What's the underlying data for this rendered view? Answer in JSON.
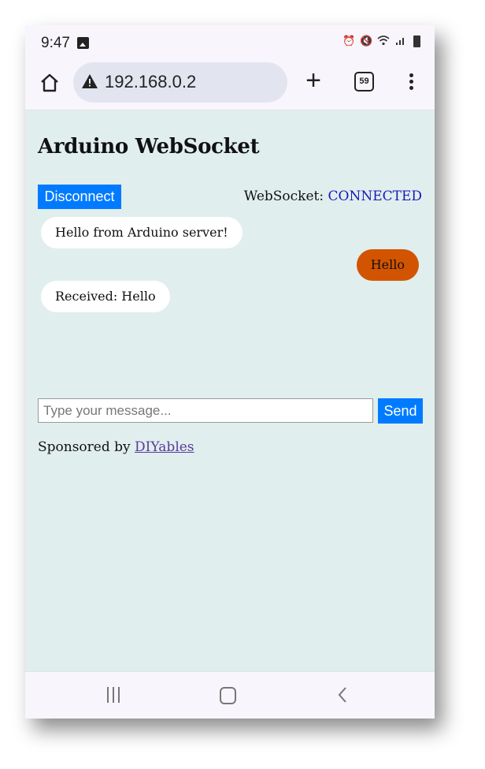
{
  "status_bar": {
    "time": "9:47",
    "left_icons": [
      "gallery-icon"
    ],
    "right_icons": [
      "alarm-icon",
      "mute-icon",
      "wifi-icon",
      "signal-icon",
      "battery-icon"
    ]
  },
  "browser": {
    "url": "192.168.0.2",
    "security_icon": "warning-icon",
    "tab_count": "59",
    "buttons": [
      "home-icon",
      "new-tab-icon",
      "tabs-icon",
      "more-icon"
    ]
  },
  "page": {
    "title": "Arduino WebSocket",
    "disconnect_label": "Disconnect",
    "ws_status_label": "WebSocket: ",
    "ws_status_value": "CONNECTED",
    "messages": [
      {
        "text": "Hello from Arduino server!",
        "type": "received"
      },
      {
        "text": "Hello",
        "type": "sent"
      },
      {
        "text": "Received: Hello",
        "type": "received"
      }
    ],
    "input_placeholder": "Type your message...",
    "input_value": "",
    "send_label": "Send",
    "sponsor_text": "Sponsored by ",
    "sponsor_link": "DIYables"
  },
  "colors": {
    "page_bg": "#e0eeee",
    "button_blue": "#007bff",
    "sent_bubble": "#d35400",
    "received_bubble": "#ffffff",
    "status_connected": "#1a1ab8"
  },
  "nav_bar": {
    "buttons": [
      "recent-apps-icon",
      "home-nav-icon",
      "back-icon"
    ]
  }
}
